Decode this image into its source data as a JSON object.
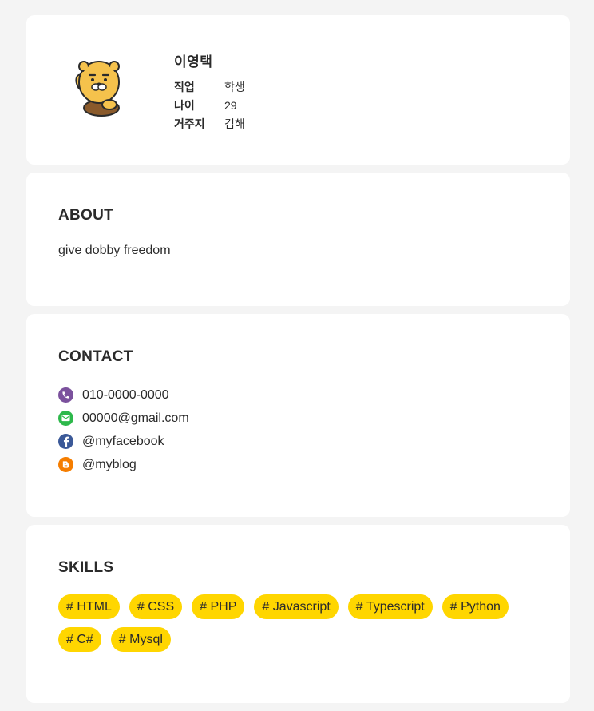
{
  "profile": {
    "name": "이영택",
    "rows": [
      {
        "key": "직업",
        "value": "학생"
      },
      {
        "key": "나이",
        "value": "29"
      },
      {
        "key": "거주지",
        "value": "김해"
      }
    ],
    "avatar_icon": "ryan-character-icon"
  },
  "about": {
    "title": "ABOUT",
    "text": "give dobby freedom"
  },
  "contact": {
    "title": "CONTACT",
    "items": [
      {
        "icon": "phone-icon",
        "text": "010-0000-0000",
        "color": "#7b519d"
      },
      {
        "icon": "mail-icon",
        "text": "00000@gmail.com",
        "color": "#2db84b"
      },
      {
        "icon": "facebook-icon",
        "text": "@myfacebook",
        "color": "#3b5998"
      },
      {
        "icon": "blog-icon",
        "text": "@myblog",
        "color": "#f57d00"
      }
    ]
  },
  "skills": {
    "title": "SKILLS",
    "tags": [
      "# HTML",
      "# CSS",
      "# PHP",
      "# Javascript",
      "# Typescript",
      "# Python",
      "# C#",
      "# Mysql"
    ],
    "tag_color": "#ffd600"
  },
  "colors": {
    "page_background": "#f4f4f4",
    "card_background": "#ffffff",
    "text": "#2b2b2b"
  }
}
